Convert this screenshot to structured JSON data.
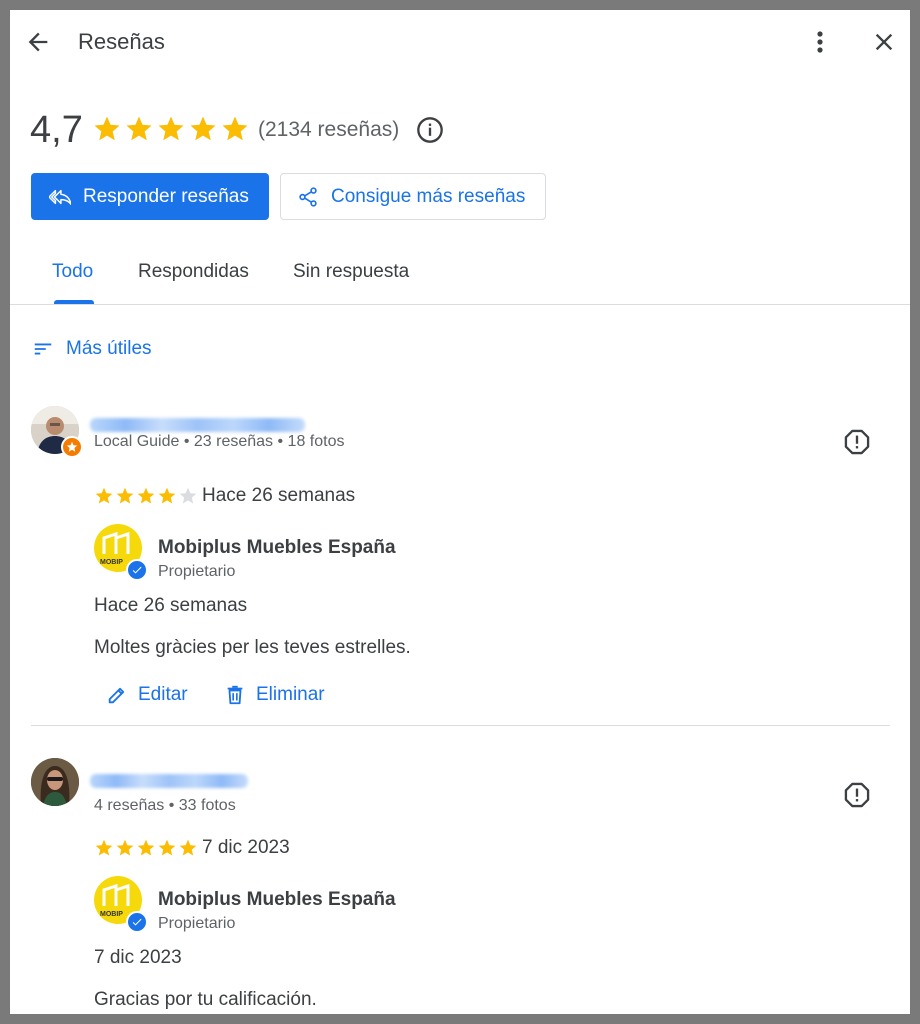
{
  "header": {
    "title": "Reseñas",
    "back_icon": "arrow-back-icon",
    "more_icon": "more-vert-icon",
    "close_icon": "close-icon"
  },
  "summary": {
    "rating": "4,7",
    "stars": 5,
    "count_text": "(2134 reseñas)",
    "info_icon": "info-icon"
  },
  "actions": {
    "respond_label": "Responder reseñas",
    "get_more_label": "Consigue más reseñas"
  },
  "tabs": [
    {
      "label": "Todo",
      "active": true
    },
    {
      "label": "Respondidas",
      "active": false
    },
    {
      "label": "Sin respuesta",
      "active": false
    }
  ],
  "sort": {
    "label": "Más útiles"
  },
  "reviews": [
    {
      "meta": "Local Guide • 23 reseñas • 18 fotos",
      "rating": 4,
      "date": "Hace 26 semanas",
      "reply": {
        "owner_name": "Mobiplus Muebles España",
        "owner_role": "Propietario",
        "date": "Hace 26 semanas",
        "text": "Moltes gràcies per les teves estrelles.",
        "edit_label": "Editar",
        "delete_label": "Eliminar"
      }
    },
    {
      "meta": "4 reseñas • 33 fotos",
      "rating": 5,
      "date": "7 dic 2023",
      "reply": {
        "owner_name": "Mobiplus Muebles España",
        "owner_role": "Propietario",
        "date": "7 dic 2023",
        "text": "Gracias por tu calificación."
      }
    }
  ],
  "owner_logo_text": "MOBIP",
  "colors": {
    "accent": "#1a73e8",
    "star": "#fbbc04",
    "star_empty": "#dadce0",
    "logo_yellow": "#f5d90a"
  }
}
